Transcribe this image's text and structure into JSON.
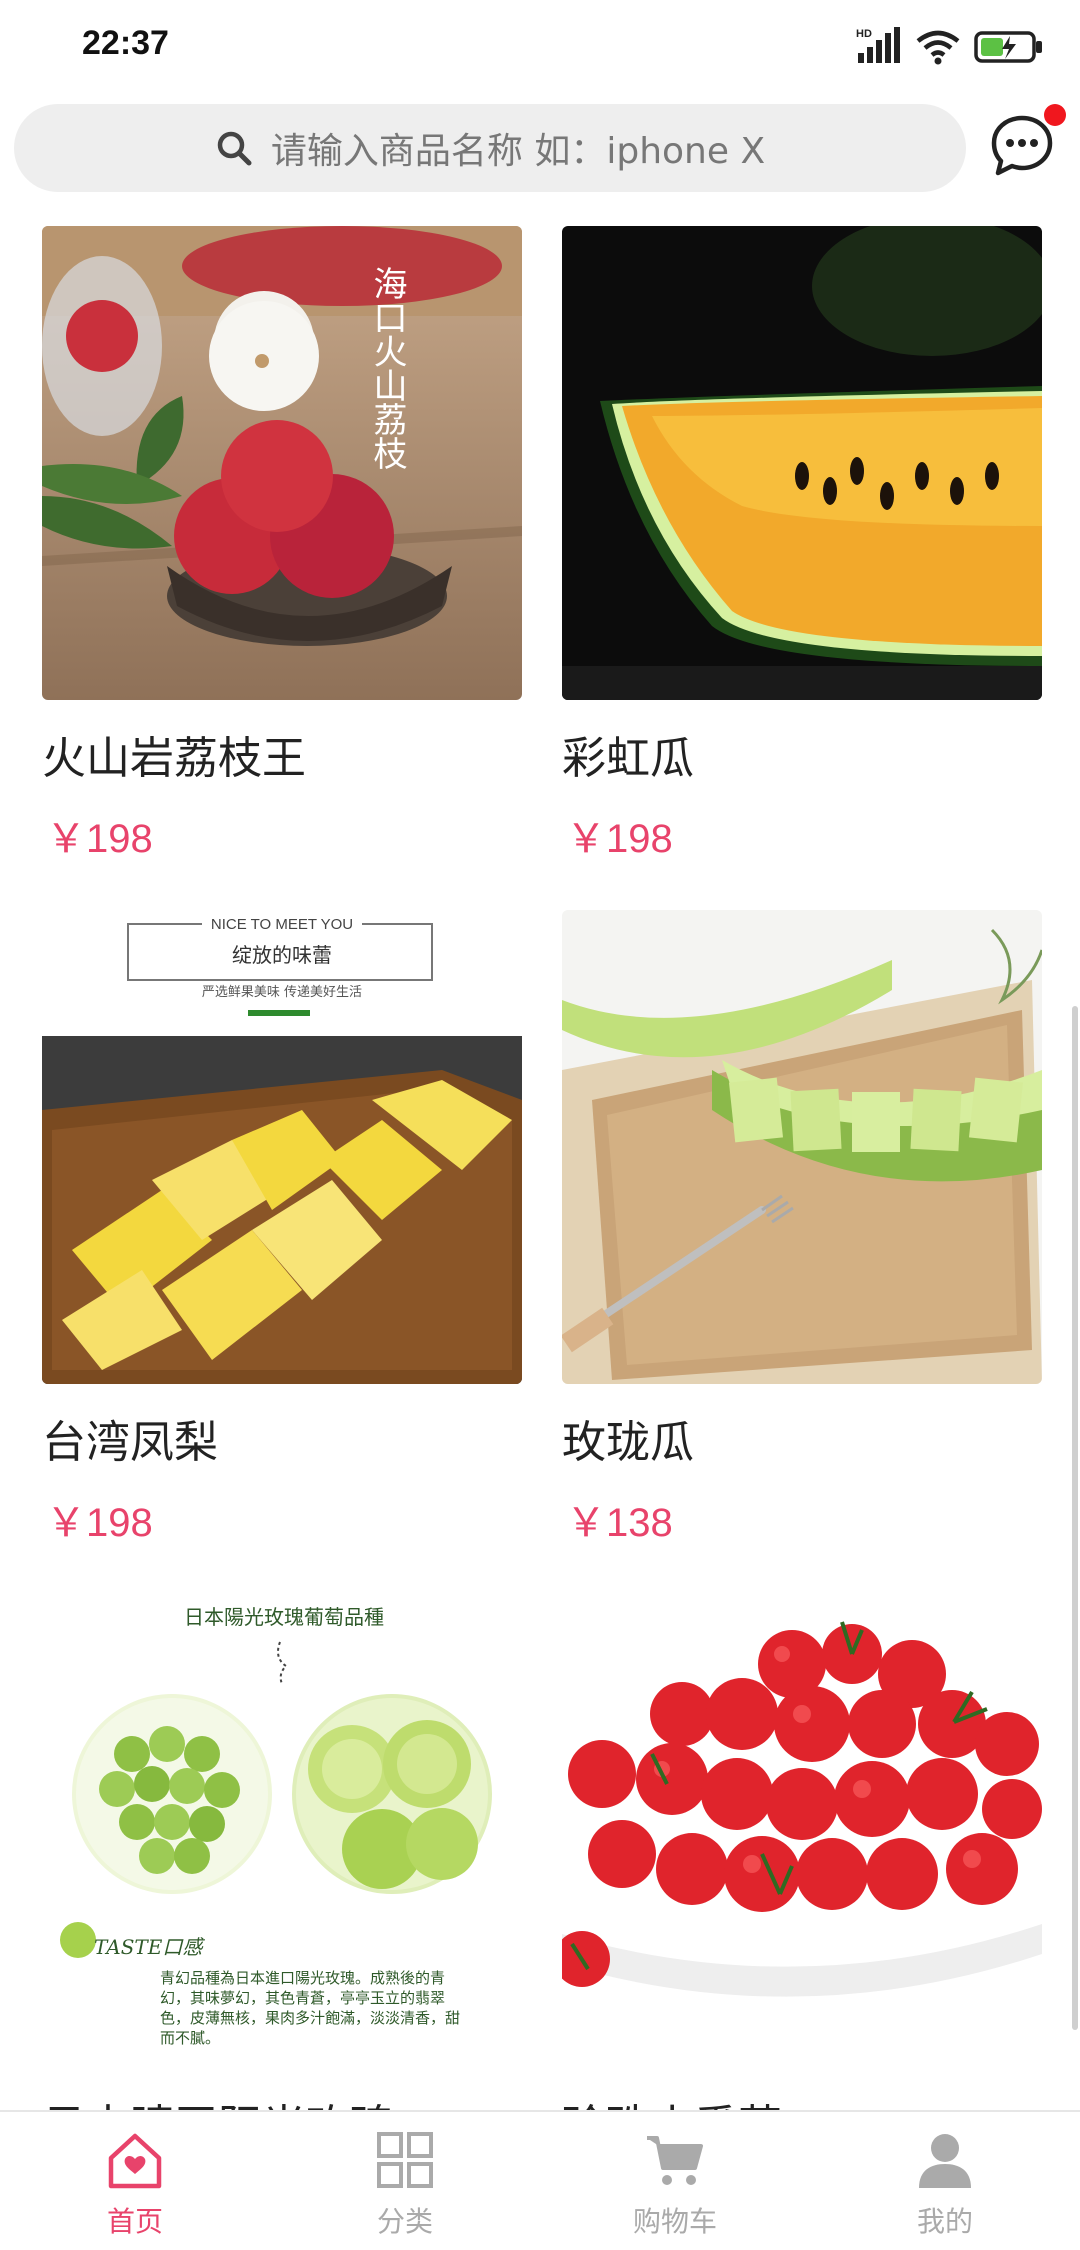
{
  "status_bar": {
    "time": "22:37",
    "network_label": "HD"
  },
  "search": {
    "placeholder": "请输入商品名称  如：iphone  X"
  },
  "products": [
    {
      "name": "火山岩荔枝王",
      "price": "￥198",
      "image_icon": "lychee-image",
      "image_caption": "海口火山荔枝"
    },
    {
      "name": "彩虹瓜",
      "price": "￥198",
      "image_icon": "watermelon-image"
    },
    {
      "name": "台湾凤梨",
      "price": "￥198",
      "image_icon": "pineapple-image",
      "banner_top": "NICE TO MEET YOU",
      "banner_title": "绽放的味蕾",
      "banner_sub": "严选鲜果美味 传递美好生活"
    },
    {
      "name": "玫珑瓜",
      "price": "￥138",
      "image_icon": "melon-image"
    },
    {
      "name": "日本晴王阳光玫瑰",
      "price": "",
      "image_icon": "grape-image",
      "banner_top": "日本陽光玫瑰葡萄品種",
      "taste_label": "TASTE口感",
      "desc": "青幻品種為日本進口陽光玫瑰。成熟後的青幻，其味夢幻，其色青蒼，亭亭玉立的翡翠色，皮薄無核，果肉多汁飽滿，淡淡清香，甜而不膩。"
    },
    {
      "name": "珍珠小番茄",
      "price": "",
      "image_icon": "tomato-image"
    }
  ],
  "nav": {
    "items": [
      {
        "label": "首页",
        "icon": "home-icon",
        "active": true
      },
      {
        "label": "分类",
        "icon": "category-grid-icon",
        "active": false
      },
      {
        "label": "购物车",
        "icon": "cart-icon",
        "active": false
      },
      {
        "label": "我的",
        "icon": "profile-icon",
        "active": false
      }
    ]
  },
  "colors": {
    "accent": "#e8436b",
    "notification_dot": "#f0171e",
    "search_bg": "#eeeeee",
    "inactive_nav": "#aaaaaa"
  }
}
